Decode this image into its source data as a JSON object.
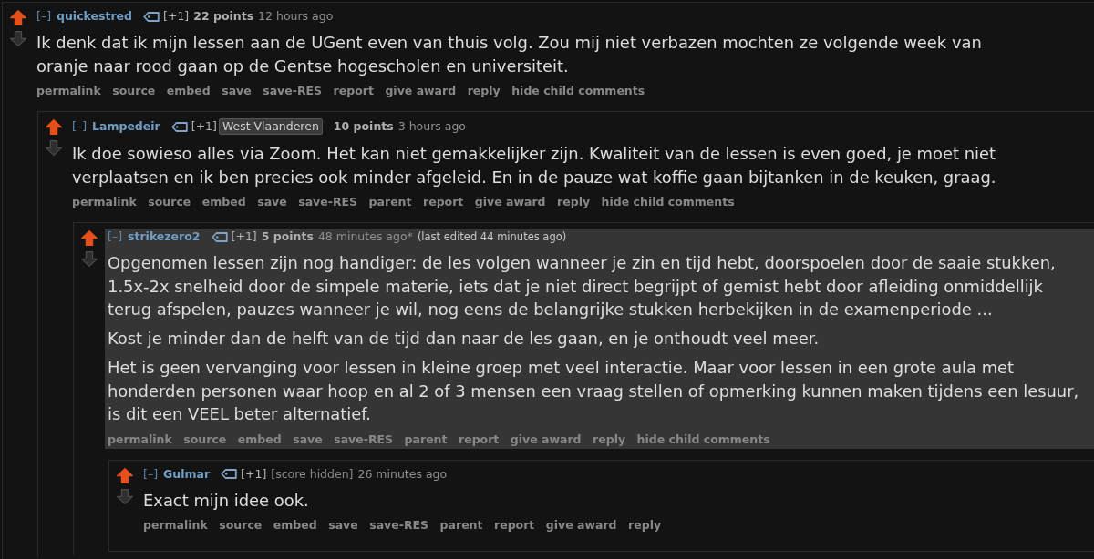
{
  "comments": [
    {
      "collapse": "[–]",
      "author": "quickestred",
      "vote_weight": "[+1]",
      "score": "22 points",
      "score_hidden": false,
      "time": "12 hours ago",
      "upvoted": true,
      "highlighted": false,
      "body": [
        "Ik denk dat ik mijn lessen aan de UGent even van thuis volg. Zou mij niet verbazen mochten ze volgende week van oranje naar rood gaan op de Gentse hogescholen en universiteit."
      ],
      "actions": [
        "permalink",
        "source",
        "embed",
        "save",
        "save-RES",
        "report",
        "give award",
        "reply",
        "hide child comments"
      ],
      "children": [
        {
          "collapse": "[–]",
          "author": "Lampedeir",
          "vote_weight": "[+1]",
          "flair": "West-Vlaanderen",
          "score": "10 points",
          "score_hidden": false,
          "time": "3 hours ago",
          "upvoted": true,
          "highlighted": false,
          "body": [
            "Ik doe sowieso alles via Zoom. Het kan niet gemakkelijker zijn. Kwaliteit van de lessen is even goed, je moet niet verplaatsen en ik ben precies ook minder afgeleid. En in de pauze wat koffie gaan bijtanken in de keuken, graag."
          ],
          "actions": [
            "permalink",
            "source",
            "embed",
            "save",
            "save-RES",
            "parent",
            "report",
            "give award",
            "reply",
            "hide child comments"
          ],
          "children": [
            {
              "collapse": "[–]",
              "author": "strikezero2",
              "vote_weight": "[+1]",
              "score": "5 points",
              "score_hidden": false,
              "time": "48 minutes ago*",
              "edit_note": "(last edited 44 minutes ago)",
              "upvoted": true,
              "highlighted": true,
              "body": [
                "Opgenomen lessen zijn nog handiger: de les volgen wanneer je zin en tijd hebt, doorspoelen door de saaie stukken, 1.5x-2x snelheid door de simpele materie, iets dat je niet direct begrijpt of gemist hebt door afleiding onmiddellijk terug afspelen, pauzes wanneer je wil, nog eens de belangrijke stukken herbekijken in de examenperiode ...",
                "Kost je minder dan de helft van de tijd dan naar de les gaan, en je onthoudt veel meer.",
                "Het is geen vervanging voor lessen in kleine groep met veel interactie. Maar voor lessen in een grote aula met honderden personen waar hoop en al 2 of 3 mensen een vraag stellen of opmerking kunnen maken tijdens een lesuur, is dit een VEEL beter alternatief."
              ],
              "actions": [
                "permalink",
                "source",
                "embed",
                "save",
                "save-RES",
                "parent",
                "report",
                "give award",
                "reply",
                "hide child comments"
              ],
              "children": [
                {
                  "collapse": "[–]",
                  "author": "Gulmar",
                  "vote_weight": "[+1]",
                  "score": "[score hidden]",
                  "score_hidden": true,
                  "time": "26 minutes ago",
                  "upvoted": true,
                  "highlighted": false,
                  "body": [
                    "Exact mijn idee ook."
                  ],
                  "actions": [
                    "permalink",
                    "source",
                    "embed",
                    "save",
                    "save-RES",
                    "parent",
                    "report",
                    "give award",
                    "reply"
                  ]
                }
              ]
            }
          ]
        }
      ]
    }
  ]
}
